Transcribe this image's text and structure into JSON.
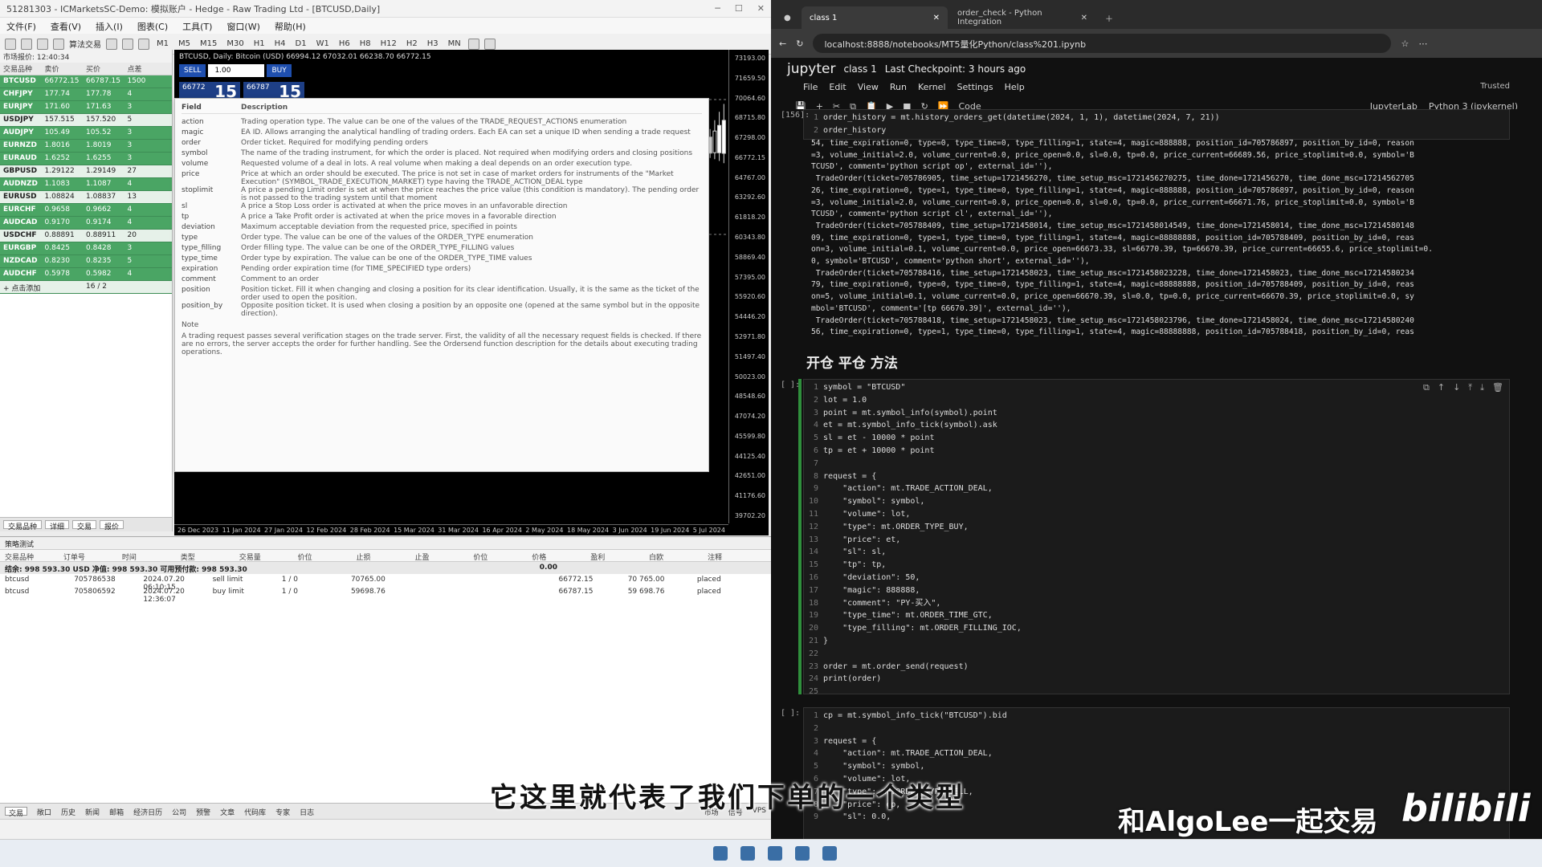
{
  "mt5": {
    "title": "51281303 - ICMarketsSC-Demo: 模拟账户 - Hedge - Raw Trading Ltd - [BTCUSD,Daily]",
    "menu": [
      "文件(F)",
      "查看(V)",
      "插入(I)",
      "图表(C)",
      "工具(T)",
      "窗口(W)",
      "帮助(H)"
    ],
    "toolbar": {
      "algo": "算法交易",
      "timeframes": [
        "M1",
        "M5",
        "M15",
        "M30",
        "H1",
        "H4",
        "D1",
        "W1",
        "H6",
        "H8",
        "H12",
        "H2",
        "H3",
        "MN"
      ]
    },
    "market_watch": {
      "header": "市场报价: 12:40:34",
      "columns": [
        "交易品种",
        "卖价",
        "买价",
        "点差"
      ],
      "rows": [
        {
          "sym": "BTCUSD",
          "bid": "66772.15",
          "ask": "66787.15",
          "spread": "1500"
        },
        {
          "sym": "CHFJPY",
          "bid": "177.74",
          "ask": "177.78",
          "spread": "4"
        },
        {
          "sym": "EURJPY",
          "bid": "171.60",
          "ask": "171.63",
          "spread": "3"
        },
        {
          "sym": "USDJPY",
          "bid": "157.515",
          "ask": "157.520",
          "spread": "5"
        },
        {
          "sym": "AUDJPY",
          "bid": "105.49",
          "ask": "105.52",
          "spread": "3"
        },
        {
          "sym": "EURNZD",
          "bid": "1.8016",
          "ask": "1.8019",
          "spread": "3"
        },
        {
          "sym": "EURAUD",
          "bid": "1.6252",
          "ask": "1.6255",
          "spread": "3"
        },
        {
          "sym": "GBPUSD",
          "bid": "1.29122",
          "ask": "1.29149",
          "spread": "27"
        },
        {
          "sym": "AUDNZD",
          "bid": "1.1083",
          "ask": "1.1087",
          "spread": "4"
        },
        {
          "sym": "EURUSD",
          "bid": "1.08824",
          "ask": "1.08837",
          "spread": "13"
        },
        {
          "sym": "EURCHF",
          "bid": "0.9658",
          "ask": "0.9662",
          "spread": "4"
        },
        {
          "sym": "AUDCAD",
          "bid": "0.9170",
          "ask": "0.9174",
          "spread": "4"
        },
        {
          "sym": "USDCHF",
          "bid": "0.88891",
          "ask": "0.88911",
          "spread": "20"
        },
        {
          "sym": "EURGBP",
          "bid": "0.8425",
          "ask": "0.8428",
          "spread": "3"
        },
        {
          "sym": "NZDCAD",
          "bid": "0.8230",
          "ask": "0.8235",
          "spread": "5"
        },
        {
          "sym": "AUDCHF",
          "bid": "0.5978",
          "ask": "0.5982",
          "spread": "4"
        }
      ],
      "add": "+ 点击添加",
      "count": "16 / 2",
      "tabs": [
        "交易品种",
        "详细",
        "交易",
        "报价"
      ]
    },
    "chart": {
      "header": "BTCUSD, Daily: Bitcoin (USD)  66994.12 67032.01 66238.70 66772.15",
      "sell": "SELL",
      "buy": "BUY",
      "lot": "1.00",
      "bid_small": "66772",
      "bid_big": "15",
      "ask_small": "66787",
      "ask_big": "15",
      "y_ticks": [
        "73193.00",
        "71659.50",
        "70064.60",
        "68715.80",
        "67298.00",
        "66772.15",
        "64767.00",
        "63292.60",
        "61818.20",
        "60343.80",
        "58869.40",
        "57395.00",
        "55920.60",
        "54446.20",
        "52971.80",
        "51497.40",
        "50023.00",
        "48548.60",
        "47074.20",
        "45599.80",
        "44125.40",
        "42651.00",
        "41176.60",
        "39702.20"
      ],
      "x_ticks": [
        "26 Dec 2023",
        "11 Jan 2024",
        "27 Jan 2024",
        "12 Feb 2024",
        "28 Feb 2024",
        "15 Mar 2024",
        "31 Mar 2024",
        "16 Apr 2024",
        "2 May 2024",
        "18 May 2024",
        "3 Jun 2024",
        "19 Jun 2024",
        "5 Jul 2024"
      ]
    },
    "tooltip": {
      "head_field": "Field",
      "head_desc": "Description",
      "rows": [
        {
          "f": "action",
          "d": "Trading operation type. The value can be one of the values of the TRADE_REQUEST_ACTIONS enumeration"
        },
        {
          "f": "magic",
          "d": "EA ID. Allows arranging the analytical handling of trading orders. Each EA can set a unique ID when sending a trade request"
        },
        {
          "f": "order",
          "d": "Order ticket. Required for modifying pending orders"
        },
        {
          "f": "symbol",
          "d": "The name of the trading instrument, for which the order is placed. Not required when modifying orders and closing positions"
        },
        {
          "f": "volume",
          "d": "Requested volume of a deal in lots. A real volume when making a deal depends on an order execution type."
        },
        {
          "f": "price",
          "d": "Price at which an order should be executed. The price is not set in case of market orders for instruments of the \"Market Execution\" (SYMBOL_TRADE_EXECUTION_MARKET) type having the TRADE_ACTION_DEAL type"
        },
        {
          "f": "stoplimit",
          "d": "A price a pending Limit order is set at when the price reaches the price value (this condition is mandatory). The pending order is not passed to the trading system until that moment"
        },
        {
          "f": "sl",
          "d": "A price a Stop Loss order is activated at when the price moves in an unfavorable direction"
        },
        {
          "f": "tp",
          "d": "A price a Take Profit order is activated at when the price moves in a favorable direction"
        },
        {
          "f": "deviation",
          "d": "Maximum acceptable deviation from the requested price, specified in points"
        },
        {
          "f": "type",
          "d": "Order type. The value can be one of the values of the ORDER_TYPE enumeration"
        },
        {
          "f": "type_filling",
          "d": "Order filling type. The value can be one of the ORDER_TYPE_FILLING values"
        },
        {
          "f": "type_time",
          "d": "Order type by expiration. The value can be one of the ORDER_TYPE_TIME values"
        },
        {
          "f": "expiration",
          "d": "Pending order expiration time (for TIME_SPECIFIED type orders)"
        },
        {
          "f": "comment",
          "d": "Comment to an order"
        },
        {
          "f": "position",
          "d": "Position ticket. Fill it when changing and closing a position for its clear identification. Usually, it is the same as the ticket of the order used to open the position."
        },
        {
          "f": "position_by",
          "d": "Opposite position ticket. It is used when closing a position by an opposite one (opened at the same symbol but in the opposite direction)."
        }
      ],
      "note_title": "Note",
      "note": "A trading request passes several verification stages on the trade server. First, the validity of all the necessary request fields is checked. If there are no errors, the server accepts the order for further handling. See the Ordersend function description for the details about executing trading operations."
    },
    "toolbox": {
      "title": "策略测试",
      "columns": [
        "交易品种",
        "订单号",
        "时间",
        "类型",
        "交易量",
        "价位",
        "止损",
        "止盈",
        "价位",
        "价格",
        "盈利",
        "白欧",
        "注释"
      ],
      "balance": "结余: 998 593.30 USD  净值: 998 593.30  可用预付款: 998 593.30",
      "balance_amt": "0.00",
      "rows": [
        [
          "btcusd",
          "705786538",
          "2024.07.20 06:10:15",
          "sell limit",
          "1 / 0",
          "70765.00",
          "",
          "",
          "66772.15",
          "70 765.00",
          "placed"
        ],
        [
          "btcusd",
          "705806592",
          "2024.07.20 12:36:07",
          "buy limit",
          "1 / 0",
          "59698.76",
          "",
          "",
          "66787.15",
          "59 698.76",
          "placed"
        ]
      ],
      "tabs": [
        "交易",
        "敞口",
        "历史",
        "新闻",
        "邮箱",
        "经济日历",
        "公司",
        "预警",
        "文章",
        "代码库",
        "专家",
        "日志"
      ],
      "right": [
        "市场",
        "信号",
        "VPS"
      ]
    }
  },
  "browser": {
    "tabs": [
      {
        "label": "class 1"
      },
      {
        "label": "order_check - Python Integration"
      }
    ],
    "url": "localhost:8888/notebooks/MT5量化Python/class%201.ipynb"
  },
  "jupyter": {
    "logo": "jupyter",
    "name": "class 1",
    "checkpoint": "Last Checkpoint: 3 hours ago",
    "menu": [
      "File",
      "Edit",
      "View",
      "Run",
      "Kernel",
      "Settings",
      "Help"
    ],
    "trusted": "Trusted",
    "cell_type": "Code",
    "jupyterlab": "JupyterLab",
    "kernel": "Python 3 (ipykernel)",
    "cell1_prompt": "[156]:",
    "cell1_code": [
      "order_history = mt.history_orders_get(datetime(2024, 1, 1), datetime(2024, 7, 21))",
      "order_history"
    ],
    "output": [
      "54, time_expiration=0, type=0, type_time=0, type_filling=1, state=4, magic=888888, position_id=705786897, position_by_id=0, reason",
      "=3, volume_initial=2.0, volume_current=0.0, price_open=0.0, sl=0.0, tp=0.0, price_current=66689.56, price_stoplimit=0.0, symbol='B",
      "TCUSD', comment='python script op', external_id=''),",
      " TradeOrder(ticket=705786905, time_setup=1721456270, time_setup_msc=1721456270275, time_done=1721456270, time_done_msc=17214562705",
      "26, time_expiration=0, type=1, type_time=0, type_filling=1, state=4, magic=888888, position_id=705786897, position_by_id=0, reason",
      "=3, volume_initial=2.0, volume_current=0.0, price_open=0.0, sl=0.0, tp=0.0, price_current=66671.76, price_stoplimit=0.0, symbol='B",
      "TCUSD', comment='python script cl', external_id=''),",
      " TradeOrder(ticket=705788409, time_setup=1721458014, time_setup_msc=1721458014549, time_done=1721458014, time_done_msc=17214580148",
      "09, time_expiration=0, type=1, type_time=0, type_filling=1, state=4, magic=88888888, position_id=705788409, position_by_id=0, reas",
      "on=3, volume_initial=0.1, volume_current=0.0, price_open=66673.33, sl=66770.39, tp=66670.39, price_current=66655.6, price_stoplimit=0.",
      "0, symbol='BTCUSD', comment='python short', external_id=''),",
      " TradeOrder(ticket=705788416, time_setup=1721458023, time_setup_msc=1721458023228, time_done=1721458023, time_done_msc=17214580234",
      "79, time_expiration=0, type=0, type_time=0, type_filling=1, state=4, magic=88888888, position_id=705788409, position_by_id=0, reas",
      "on=5, volume_initial=0.1, volume_current=0.0, price_open=66670.39, sl=0.0, tp=0.0, price_current=66670.39, price_stoplimit=0.0, sy",
      "mbol='BTCUSD', comment='[tp 66670.39]', external_id=''),",
      " TradeOrder(ticket=705788418, time_setup=1721458023, time_setup_msc=1721458023796, time_done=1721458024, time_done_msc=17214580240",
      "56, time_expiration=0, type=1, type_time=0, type_filling=1, state=4, magic=88888888, position_id=705788418, position_by_id=0, reas"
    ],
    "heading": "开仓 平仓 方法",
    "cell2_prompt": "[ ]:",
    "cell2_code": [
      "symbol = \"BTCUSD\"",
      "lot = 1.0",
      "point = mt.symbol_info(symbol).point",
      "et = mt.symbol_info_tick(symbol).ask",
      "sl = et - 10000 * point",
      "tp = et + 10000 * point",
      "",
      "request = {",
      "    \"action\": mt.TRADE_ACTION_DEAL,",
      "    \"symbol\": symbol,",
      "    \"volume\": lot,",
      "    \"type\": mt.ORDER_TYPE_BUY,",
      "    \"price\": et,",
      "    \"sl\": sl,",
      "    \"tp\": tp,",
      "    \"deviation\": 50,",
      "    \"magic\": 888888,",
      "    \"comment\": \"PY-买入\",",
      "    \"type_time\": mt.ORDER_TIME_GTC,",
      "    \"type_filling\": mt.ORDER_FILLING_IOC,",
      "}",
      "",
      "order = mt.order_send(request)",
      "print(order)",
      ""
    ],
    "cell3_prompt": "[ ]:",
    "cell3_code": [
      "cp = mt.symbol_info_tick(\"BTCUSD\").bid",
      "",
      "request = {",
      "    \"action\": mt.TRADE_ACTION_DEAL,",
      "    \"symbol\": symbol,",
      "    \"volume\": lot,",
      "    \"type\": mt.ORDER_TYPE_SELL,",
      "    \"price\": cp,",
      "    \"sl\": 0.0,"
    ]
  },
  "overlay": {
    "subtitle": "它这里就代表了我们下单的一个类型",
    "watermark": "和AlgoLee一起交易",
    "logo": "bilibili"
  }
}
